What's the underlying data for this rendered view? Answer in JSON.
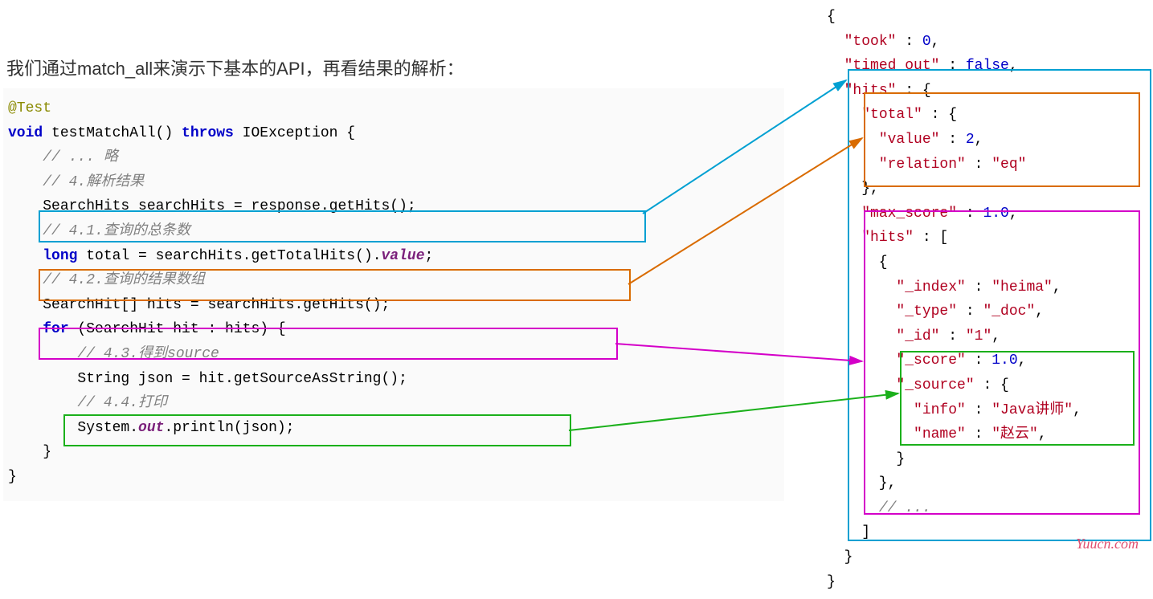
{
  "heading": "我们通过match_all来演示下基本的API，再看结果的解析：",
  "java": {
    "anno": "@Test",
    "kw_void": "void",
    "fn": " testMatchAll() ",
    "kw_throws": "throws",
    "exc": " IOException {",
    "c_skip": "// ... 略",
    "c4": "// 4.解析结果",
    "l_hits": "SearchHits searchHits = response.getHits();",
    "c41": "// 4.1.查询的总条数",
    "kw_long": "long",
    "l_total_a": " total = searchHits.getTotalHits().",
    "l_total_b": "value",
    "l_total_c": ";",
    "c42": "// 4.2.查询的结果数组",
    "l_arr": "SearchHit[] hits = searchHits.getHits();",
    "kw_for": "for",
    "l_for": " (SearchHit hit : hits) {",
    "c43": "// 4.3.得到source",
    "l_src": "String json = hit.getSourceAsString();",
    "c44": "// 4.4.打印",
    "l_print_a": "System.",
    "l_print_b": "out",
    "l_print_c": ".println(json);",
    "close1": "}",
    "close2": "}"
  },
  "json": {
    "open": "{",
    "took_k": "\"took\"",
    "took_v": "0",
    "timed_k": "\"timed_out\"",
    "timed_v": "false",
    "hits_k": "\"hits\"",
    "total_k": "\"total\"",
    "value_k": "\"value\"",
    "value_v": "2",
    "rel_k": "\"relation\"",
    "rel_v": "\"eq\"",
    "max_k": "\"max_score\"",
    "max_v": "1.0",
    "hits2_k": "\"hits\"",
    "idx_k": "\"_index\"",
    "idx_v": "\"heima\"",
    "type_k": "\"_type\"",
    "type_v": "\"_doc\"",
    "id_k": "\"_id\"",
    "id_v": "\"1\"",
    "score_k": "\"_score\"",
    "score_v": "1.0",
    "src_k": "\"_source\"",
    "info_k": "\"info\"",
    "info_v": "\"Java讲师\"",
    "name_k": "\"name\"",
    "name_v": "\"赵云\"",
    "ellipsis": "// ...",
    "close": "}"
  },
  "watermark": "Yuucn.com",
  "chart_data": {
    "type": "table",
    "title": "Java SearchHits parsing vs JSON response mapping",
    "mappings": [
      {
        "java_line": "SearchHits searchHits = response.getHits();",
        "json_path": "hits",
        "color": "#00a0d2"
      },
      {
        "java_line": "long total = searchHits.getTotalHits().value;",
        "json_path": "hits.total",
        "color": "#d96b00"
      },
      {
        "java_line": "SearchHit[] hits = searchHits.getHits();",
        "json_path": "hits.hits",
        "color": "#d400c8"
      },
      {
        "java_line": "String json = hit.getSourceAsString();",
        "json_path": "hits.hits[]._source",
        "color": "#1bb01b"
      }
    ],
    "json_response": {
      "took": 0,
      "timed_out": false,
      "hits": {
        "total": {
          "value": 2,
          "relation": "eq"
        },
        "max_score": 1.0,
        "hits": [
          {
            "_index": "heima",
            "_type": "_doc",
            "_id": "1",
            "_score": 1.0,
            "_source": {
              "info": "Java讲师",
              "name": "赵云"
            }
          }
        ]
      }
    }
  }
}
